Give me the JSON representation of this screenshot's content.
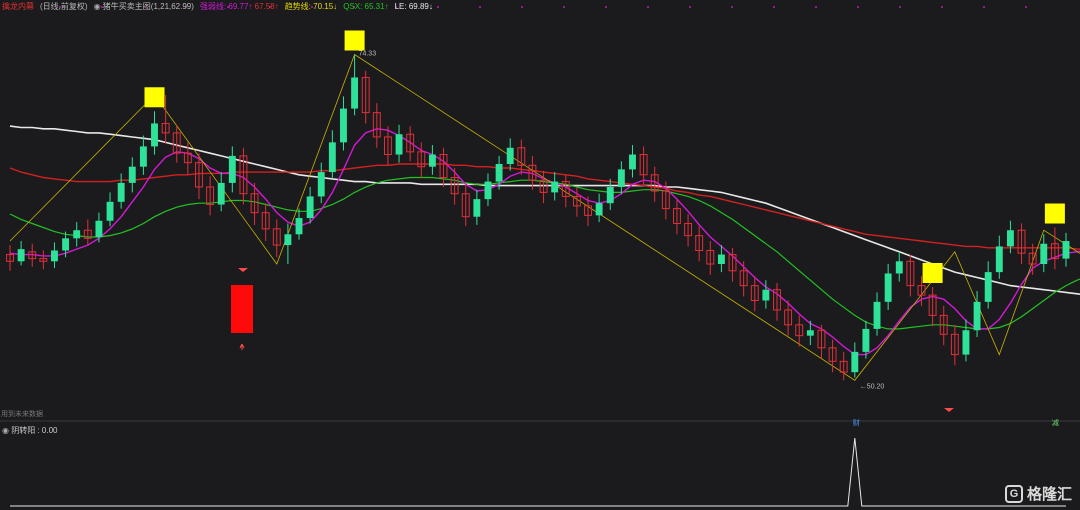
{
  "header": {
    "indicator_name": "擒龙内幕",
    "period": "(日线,前复权)",
    "formula": "猪牛买卖主图(1,21,62.99)",
    "qiangruo_label": "强弱线:",
    "qiangruo_value": "69.77↑",
    "qiangruo_value2": "67.58↑",
    "trend_label": "趋势线:",
    "trend_value": "70.15↓",
    "qsx_label": "QSX:",
    "qsx_value": "65.31↑",
    "le_label": "LE:",
    "le_value": "69.89↓"
  },
  "annotations": {
    "high_label": "74.33",
    "low_label": "←50.20",
    "future_data_note": "用到未来数据",
    "marker_left": "财",
    "marker_right": "减"
  },
  "sub_panel": {
    "label": "阴转阳",
    "value": ": 0.00"
  },
  "watermark": {
    "logo": "G",
    "text": "格隆汇"
  },
  "colors": {
    "up": "#2fe29a",
    "down": "#e0303a",
    "pink": "#d418d8",
    "green_ma": "#22c222",
    "red_ma": "#d42020",
    "white_ma": "#e8e8e8",
    "zigzag": "#c8b400",
    "signal_box": "#ffff00"
  },
  "chart_data": {
    "type": "candlestick",
    "ylim": [
      48,
      77
    ],
    "candles": [
      {
        "o": 59.5,
        "c": 59.0,
        "h": 60.2,
        "l": 58.3
      },
      {
        "o": 59.0,
        "c": 59.9,
        "h": 60.5,
        "l": 58.7
      },
      {
        "o": 59.7,
        "c": 59.2,
        "h": 60.3,
        "l": 58.6
      },
      {
        "o": 59.2,
        "c": 59.0,
        "h": 59.8,
        "l": 58.4
      },
      {
        "o": 59.0,
        "c": 59.8,
        "h": 60.4,
        "l": 58.5
      },
      {
        "o": 59.8,
        "c": 60.7,
        "h": 61.2,
        "l": 59.3
      },
      {
        "o": 60.7,
        "c": 61.3,
        "h": 61.9,
        "l": 60.1
      },
      {
        "o": 61.3,
        "c": 60.7,
        "h": 62.1,
        "l": 60.2
      },
      {
        "o": 60.8,
        "c": 62.0,
        "h": 62.6,
        "l": 60.4
      },
      {
        "o": 62.0,
        "c": 63.4,
        "h": 64.1,
        "l": 61.6
      },
      {
        "o": 63.4,
        "c": 64.8,
        "h": 65.5,
        "l": 62.9
      },
      {
        "o": 64.8,
        "c": 66.0,
        "h": 66.7,
        "l": 64.1
      },
      {
        "o": 66.0,
        "c": 67.5,
        "h": 68.3,
        "l": 65.4
      },
      {
        "o": 67.5,
        "c": 69.2,
        "h": 70.1,
        "l": 66.9
      },
      {
        "o": 69.2,
        "c": 68.5,
        "h": 71.3,
        "l": 67.7
      },
      {
        "o": 68.5,
        "c": 67.0,
        "h": 69.1,
        "l": 66.3
      },
      {
        "o": 67.0,
        "c": 66.3,
        "h": 67.8,
        "l": 65.4
      },
      {
        "o": 66.3,
        "c": 64.5,
        "h": 67.0,
        "l": 63.6
      },
      {
        "o": 64.5,
        "c": 63.2,
        "h": 65.3,
        "l": 62.4
      },
      {
        "o": 63.2,
        "c": 64.8,
        "h": 65.6,
        "l": 62.7
      },
      {
        "o": 64.8,
        "c": 66.8,
        "h": 67.5,
        "l": 64.1
      },
      {
        "o": 66.8,
        "c": 64.0,
        "h": 67.4,
        "l": 63.2
      },
      {
        "o": 64.0,
        "c": 62.6,
        "h": 64.8,
        "l": 61.7
      },
      {
        "o": 62.6,
        "c": 61.4,
        "h": 63.3,
        "l": 60.5
      },
      {
        "o": 61.4,
        "c": 60.2,
        "h": 62.1,
        "l": 59.3
      },
      {
        "o": 60.2,
        "c": 61.0,
        "h": 61.8,
        "l": 58.8
      },
      {
        "o": 61.0,
        "c": 62.2,
        "h": 62.9,
        "l": 60.6
      },
      {
        "o": 62.2,
        "c": 63.8,
        "h": 64.5,
        "l": 61.8
      },
      {
        "o": 63.8,
        "c": 65.6,
        "h": 66.3,
        "l": 63.3
      },
      {
        "o": 65.6,
        "c": 67.8,
        "h": 68.7,
        "l": 65.1
      },
      {
        "o": 67.8,
        "c": 70.3,
        "h": 71.2,
        "l": 67.2
      },
      {
        "o": 70.3,
        "c": 72.6,
        "h": 74.3,
        "l": 69.8
      },
      {
        "o": 72.6,
        "c": 70.0,
        "h": 73.1,
        "l": 69.2
      },
      {
        "o": 70.0,
        "c": 68.2,
        "h": 70.7,
        "l": 67.4
      },
      {
        "o": 68.2,
        "c": 66.9,
        "h": 69.0,
        "l": 66.1
      },
      {
        "o": 66.9,
        "c": 68.4,
        "h": 69.1,
        "l": 66.3
      },
      {
        "o": 68.4,
        "c": 67.1,
        "h": 69.0,
        "l": 66.4
      },
      {
        "o": 67.1,
        "c": 66.0,
        "h": 67.8,
        "l": 65.2
      },
      {
        "o": 66.0,
        "c": 66.9,
        "h": 67.6,
        "l": 65.4
      },
      {
        "o": 66.9,
        "c": 65.2,
        "h": 67.4,
        "l": 64.5
      },
      {
        "o": 65.2,
        "c": 64.0,
        "h": 65.9,
        "l": 63.2
      },
      {
        "o": 64.0,
        "c": 62.3,
        "h": 64.7,
        "l": 61.6
      },
      {
        "o": 62.3,
        "c": 63.6,
        "h": 64.3,
        "l": 61.7
      },
      {
        "o": 63.6,
        "c": 64.9,
        "h": 65.5,
        "l": 63.1
      },
      {
        "o": 64.9,
        "c": 66.2,
        "h": 66.8,
        "l": 64.3
      },
      {
        "o": 66.2,
        "c": 67.4,
        "h": 68.1,
        "l": 65.7
      },
      {
        "o": 67.4,
        "c": 66.1,
        "h": 68.0,
        "l": 65.4
      },
      {
        "o": 66.1,
        "c": 65.0,
        "h": 66.8,
        "l": 64.3
      },
      {
        "o": 65.0,
        "c": 64.1,
        "h": 65.7,
        "l": 63.3
      },
      {
        "o": 64.1,
        "c": 64.9,
        "h": 65.6,
        "l": 63.5
      },
      {
        "o": 64.9,
        "c": 63.8,
        "h": 65.4,
        "l": 63.0
      },
      {
        "o": 63.8,
        "c": 63.1,
        "h": 64.5,
        "l": 62.3
      },
      {
        "o": 63.1,
        "c": 62.4,
        "h": 63.8,
        "l": 61.6
      },
      {
        "o": 62.4,
        "c": 63.3,
        "h": 64.0,
        "l": 61.9
      },
      {
        "o": 63.3,
        "c": 64.5,
        "h": 65.1,
        "l": 62.8
      },
      {
        "o": 64.5,
        "c": 65.8,
        "h": 66.4,
        "l": 64.0
      },
      {
        "o": 65.8,
        "c": 66.9,
        "h": 67.6,
        "l": 65.2
      },
      {
        "o": 66.9,
        "c": 65.4,
        "h": 67.5,
        "l": 64.7
      },
      {
        "o": 65.4,
        "c": 64.2,
        "h": 66.0,
        "l": 63.4
      },
      {
        "o": 64.2,
        "c": 62.9,
        "h": 64.9,
        "l": 62.1
      },
      {
        "o": 62.9,
        "c": 61.8,
        "h": 63.6,
        "l": 61.0
      },
      {
        "o": 61.8,
        "c": 60.9,
        "h": 62.5,
        "l": 60.1
      },
      {
        "o": 60.9,
        "c": 59.8,
        "h": 61.6,
        "l": 59.0
      },
      {
        "o": 59.8,
        "c": 58.8,
        "h": 60.5,
        "l": 58.0
      },
      {
        "o": 58.8,
        "c": 59.5,
        "h": 60.2,
        "l": 58.2
      },
      {
        "o": 59.5,
        "c": 58.3,
        "h": 60.0,
        "l": 57.5
      },
      {
        "o": 58.3,
        "c": 57.2,
        "h": 59.0,
        "l": 56.4
      },
      {
        "o": 57.2,
        "c": 56.1,
        "h": 57.9,
        "l": 55.3
      },
      {
        "o": 56.1,
        "c": 56.9,
        "h": 57.6,
        "l": 55.5
      },
      {
        "o": 56.9,
        "c": 55.4,
        "h": 57.4,
        "l": 54.6
      },
      {
        "o": 55.4,
        "c": 54.3,
        "h": 56.1,
        "l": 53.5
      },
      {
        "o": 54.3,
        "c": 53.5,
        "h": 55.0,
        "l": 52.7
      },
      {
        "o": 53.5,
        "c": 53.9,
        "h": 54.6,
        "l": 52.8
      },
      {
        "o": 53.9,
        "c": 52.6,
        "h": 54.3,
        "l": 51.8
      },
      {
        "o": 52.6,
        "c": 51.6,
        "h": 53.2,
        "l": 50.8
      },
      {
        "o": 51.6,
        "c": 50.8,
        "h": 52.3,
        "l": 50.2
      },
      {
        "o": 50.8,
        "c": 52.3,
        "h": 53.0,
        "l": 50.4
      },
      {
        "o": 52.3,
        "c": 54.0,
        "h": 54.6,
        "l": 51.8
      },
      {
        "o": 54.0,
        "c": 56.0,
        "h": 56.7,
        "l": 53.5
      },
      {
        "o": 56.0,
        "c": 58.1,
        "h": 58.8,
        "l": 55.4
      },
      {
        "o": 58.1,
        "c": 59.0,
        "h": 59.7,
        "l": 57.5
      },
      {
        "o": 59.0,
        "c": 57.2,
        "h": 59.5,
        "l": 56.4
      },
      {
        "o": 57.2,
        "c": 56.5,
        "h": 57.9,
        "l": 55.7
      },
      {
        "o": 56.5,
        "c": 55.0,
        "h": 57.1,
        "l": 54.2
      },
      {
        "o": 55.0,
        "c": 53.6,
        "h": 55.7,
        "l": 52.8
      },
      {
        "o": 53.6,
        "c": 52.1,
        "h": 54.3,
        "l": 51.3
      },
      {
        "o": 52.1,
        "c": 53.9,
        "h": 54.7,
        "l": 51.6
      },
      {
        "o": 53.9,
        "c": 56.0,
        "h": 56.8,
        "l": 53.4
      },
      {
        "o": 56.0,
        "c": 58.2,
        "h": 59.0,
        "l": 55.5
      },
      {
        "o": 58.2,
        "c": 60.1,
        "h": 60.9,
        "l": 57.7
      },
      {
        "o": 60.1,
        "c": 61.3,
        "h": 62.0,
        "l": 59.6
      },
      {
        "o": 61.3,
        "c": 59.6,
        "h": 61.8,
        "l": 58.8
      },
      {
        "o": 59.6,
        "c": 58.8,
        "h": 60.3,
        "l": 58.0
      },
      {
        "o": 58.8,
        "c": 60.3,
        "h": 61.0,
        "l": 58.2
      },
      {
        "o": 60.3,
        "c": 59.2,
        "h": 61.5,
        "l": 58.4
      },
      {
        "o": 59.2,
        "c": 60.5,
        "h": 61.1,
        "l": 58.6
      }
    ],
    "ma_pink": [
      59.6,
      59.5,
      59.5,
      59.4,
      59.4,
      59.6,
      59.9,
      60.2,
      60.7,
      61.4,
      62.3,
      63.4,
      64.5,
      65.8,
      66.7,
      67.1,
      67.0,
      66.6,
      65.9,
      65.5,
      65.5,
      65.2,
      64.5,
      63.6,
      62.6,
      61.9,
      61.6,
      61.9,
      62.8,
      64.1,
      65.8,
      67.6,
      68.5,
      68.8,
      68.7,
      68.3,
      67.8,
      67.2,
      66.9,
      66.4,
      65.6,
      64.7,
      64.2,
      64.3,
      64.7,
      65.3,
      65.6,
      65.5,
      65.1,
      64.8,
      64.5,
      64.0,
      63.5,
      63.3,
      63.5,
      64.0,
      64.7,
      65.0,
      64.9,
      64.4,
      63.6,
      62.7,
      61.7,
      60.8,
      60.1,
      59.4,
      58.6,
      57.8,
      57.1,
      56.6,
      55.9,
      55.1,
      54.4,
      54.0,
      53.4,
      52.7,
      52.1,
      52.1,
      52.6,
      53.5,
      54.6,
      55.6,
      56.2,
      56.4,
      56.2,
      55.5,
      54.6,
      54.0,
      54.0,
      54.7,
      55.9,
      57.3,
      58.5,
      59.0,
      59.3,
      59.6,
      59.7,
      59.9
    ],
    "ma_green": [
      62.5,
      62.1,
      61.8,
      61.5,
      61.2,
      61.0,
      60.9,
      60.8,
      60.8,
      60.9,
      61.1,
      61.4,
      61.8,
      62.3,
      62.7,
      63.0,
      63.2,
      63.3,
      63.3,
      63.4,
      63.5,
      63.5,
      63.4,
      63.2,
      63.0,
      62.8,
      62.7,
      62.7,
      62.9,
      63.2,
      63.6,
      64.1,
      64.5,
      64.8,
      65.0,
      65.1,
      65.2,
      65.2,
      65.2,
      65.1,
      65.0,
      64.8,
      64.7,
      64.7,
      64.8,
      64.9,
      65.0,
      65.0,
      64.9,
      64.8,
      64.7,
      64.5,
      64.3,
      64.2,
      64.1,
      64.1,
      64.2,
      64.3,
      64.3,
      64.2,
      64.0,
      63.8,
      63.5,
      63.1,
      62.6,
      62.1,
      61.5,
      60.9,
      60.3,
      59.7,
      59.0,
      58.3,
      57.6,
      56.9,
      56.2,
      55.6,
      55.0,
      54.5,
      54.2,
      54.0,
      54.0,
      54.1,
      54.2,
      54.3,
      54.3,
      54.2,
      54.1,
      54.0,
      54.0,
      54.1,
      54.4,
      54.9,
      55.5,
      56.1,
      56.7,
      57.2,
      57.6,
      57.9
    ],
    "ma_red": [
      65.9,
      65.6,
      65.4,
      65.2,
      65.1,
      65.0,
      64.9,
      64.9,
      64.9,
      64.9,
      65.0,
      65.0,
      65.1,
      65.2,
      65.3,
      65.4,
      65.4,
      65.5,
      65.5,
      65.5,
      65.6,
      65.6,
      65.6,
      65.6,
      65.6,
      65.6,
      65.6,
      65.6,
      65.7,
      65.7,
      65.8,
      65.9,
      66.0,
      66.1,
      66.1,
      66.2,
      66.2,
      66.2,
      66.2,
      66.2,
      66.1,
      66.1,
      66.0,
      66.0,
      65.9,
      65.9,
      65.8,
      65.7,
      65.6,
      65.5,
      65.4,
      65.3,
      65.1,
      65.0,
      64.9,
      64.8,
      64.7,
      64.6,
      64.5,
      64.4,
      64.2,
      64.1,
      63.9,
      63.8,
      63.6,
      63.4,
      63.2,
      63.0,
      62.8,
      62.6,
      62.4,
      62.2,
      62.0,
      61.8,
      61.6,
      61.4,
      61.2,
      61.0,
      60.9,
      60.8,
      60.7,
      60.6,
      60.5,
      60.4,
      60.3,
      60.2,
      60.1,
      60.1,
      60.0,
      60.0,
      60.0,
      60.0,
      60.0,
      60.0,
      60.0,
      60.0,
      59.9,
      59.9
    ],
    "ma_white": [
      69.0,
      68.9,
      68.9,
      68.8,
      68.8,
      68.7,
      68.6,
      68.5,
      68.5,
      68.4,
      68.3,
      68.2,
      68.1,
      68.0,
      67.8,
      67.6,
      67.4,
      67.2,
      67.0,
      66.8,
      66.6,
      66.4,
      66.2,
      66.0,
      65.8,
      65.6,
      65.4,
      65.3,
      65.2,
      65.1,
      65.0,
      64.9,
      64.9,
      64.8,
      64.8,
      64.8,
      64.8,
      64.7,
      64.7,
      64.7,
      64.7,
      64.7,
      64.7,
      64.6,
      64.6,
      64.6,
      64.6,
      64.6,
      64.6,
      64.6,
      64.6,
      64.6,
      64.6,
      64.6,
      64.6,
      64.6,
      64.6,
      64.6,
      64.6,
      64.5,
      64.5,
      64.4,
      64.3,
      64.2,
      64.1,
      63.9,
      63.7,
      63.5,
      63.3,
      63.0,
      62.7,
      62.4,
      62.1,
      61.8,
      61.5,
      61.2,
      60.9,
      60.6,
      60.3,
      60.0,
      59.7,
      59.4,
      59.1,
      58.8,
      58.5,
      58.2,
      58.0,
      57.8,
      57.6,
      57.4,
      57.2,
      57.1,
      57.0,
      56.9,
      56.8,
      56.7,
      56.6,
      56.5
    ],
    "zigzag": [
      [
        0,
        60.5
      ],
      [
        13,
        71.3
      ],
      [
        24,
        58.8
      ],
      [
        31,
        74.3
      ],
      [
        76,
        50.2
      ],
      [
        85,
        59.7
      ],
      [
        89,
        52.1
      ],
      [
        93,
        61.3
      ],
      [
        97,
        59.2
      ]
    ],
    "signal_boxes_at": [
      13,
      31,
      83,
      94
    ],
    "sub_spike_at": 76
  }
}
